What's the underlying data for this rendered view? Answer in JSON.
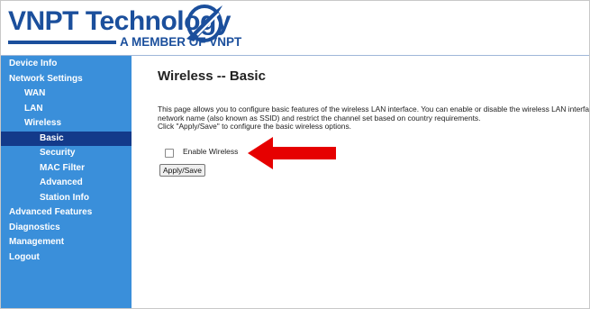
{
  "header": {
    "brand": "VNPT Technology",
    "tagline": "A MEMBER OF VNPT"
  },
  "sidebar": {
    "items": [
      {
        "label": "Device Info",
        "level": 0,
        "selected": false
      },
      {
        "label": "Network Settings",
        "level": 0,
        "selected": false
      },
      {
        "label": "WAN",
        "level": 1,
        "selected": false
      },
      {
        "label": "LAN",
        "level": 1,
        "selected": false
      },
      {
        "label": "Wireless",
        "level": 1,
        "selected": false
      },
      {
        "label": "Basic",
        "level": 2,
        "selected": true
      },
      {
        "label": "Security",
        "level": 2,
        "selected": false
      },
      {
        "label": "MAC Filter",
        "level": 2,
        "selected": false
      },
      {
        "label": "Advanced",
        "level": 2,
        "selected": false
      },
      {
        "label": "Station Info",
        "level": 2,
        "selected": false
      },
      {
        "label": "Advanced Features",
        "level": 0,
        "selected": false
      },
      {
        "label": "Diagnostics",
        "level": 0,
        "selected": false
      },
      {
        "label": "Management",
        "level": 0,
        "selected": false
      },
      {
        "label": "Logout",
        "level": 0,
        "selected": false
      }
    ]
  },
  "main": {
    "title": "Wireless -- Basic",
    "description_lines": [
      "This page allows you to configure basic features of the wireless LAN interface. You can enable or disable the wireless LAN interface, hide the network from active scans, set the wireless",
      "network name (also known as SSID) and restrict the channel set based on country requirements.",
      "Click \"Apply/Save\" to configure the basic wireless options."
    ],
    "enable_wireless_label": "Enable Wireless",
    "enable_wireless_checked": false,
    "apply_button_label": "Apply/Save"
  },
  "colors": {
    "brand_blue": "#1b4f9c",
    "sidebar_bg": "#3a8fda",
    "sidebar_selected": "#133a8a",
    "annotation_arrow": "#e60000"
  },
  "icons": {
    "logo": "vnpt-swoosh-logo",
    "annotation": "red-arrow-left"
  }
}
